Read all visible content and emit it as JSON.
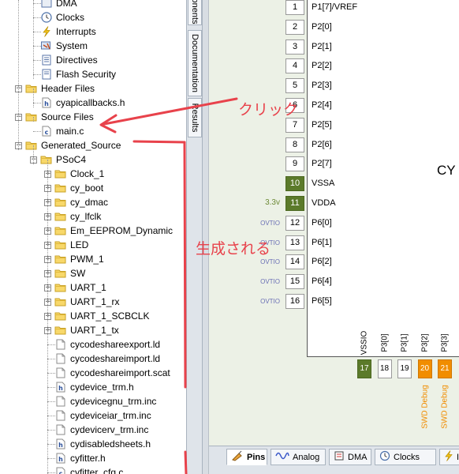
{
  "tree": {
    "items": [
      {
        "label": "DMA",
        "icon": "dma-icon",
        "level": 2
      },
      {
        "label": "Clocks",
        "icon": "clock-icon",
        "level": 2
      },
      {
        "label": "Interrupts",
        "icon": "lightning-icon",
        "level": 2
      },
      {
        "label": "System",
        "icon": "system-icon",
        "level": 2
      },
      {
        "label": "Directives",
        "icon": "document-icon",
        "level": 2
      },
      {
        "label": "Flash Security",
        "icon": "lock-icon",
        "level": 2
      },
      {
        "label": "Header Files",
        "icon": "folder-icon",
        "level": 1,
        "expander": "−"
      },
      {
        "label": "cyapicallbacks.h",
        "icon": "header-file-icon",
        "level": 2
      },
      {
        "label": "Source Files",
        "icon": "folder-icon",
        "level": 1,
        "expander": "−"
      },
      {
        "label": "main.c",
        "icon": "c-file-icon",
        "level": 2
      },
      {
        "label": "Generated_Source",
        "icon": "folder-icon",
        "level": 1,
        "expander": "−"
      },
      {
        "label": "PSoC4",
        "icon": "folder-icon",
        "level": 2,
        "expander": "−"
      },
      {
        "label": "Clock_1",
        "icon": "folder-icon",
        "level": 3,
        "expander": "+"
      },
      {
        "label": "cy_boot",
        "icon": "folder-icon",
        "level": 3,
        "expander": "+"
      },
      {
        "label": "cy_dmac",
        "icon": "folder-icon",
        "level": 3,
        "expander": "+"
      },
      {
        "label": "cy_lfclk",
        "icon": "folder-icon",
        "level": 3,
        "expander": "+"
      },
      {
        "label": "Em_EEPROM_Dynamic",
        "icon": "folder-icon",
        "level": 3,
        "expander": "+"
      },
      {
        "label": "LED",
        "icon": "folder-icon",
        "level": 3,
        "expander": "+"
      },
      {
        "label": "PWM_1",
        "icon": "folder-icon",
        "level": 3,
        "expander": "+"
      },
      {
        "label": "SW",
        "icon": "folder-icon",
        "level": 3,
        "expander": "+"
      },
      {
        "label": "UART_1",
        "icon": "folder-icon",
        "level": 3,
        "expander": "+"
      },
      {
        "label": "UART_1_rx",
        "icon": "folder-icon",
        "level": 3,
        "expander": "+"
      },
      {
        "label": "UART_1_SCBCLK",
        "icon": "folder-icon",
        "level": 3,
        "expander": "+"
      },
      {
        "label": "UART_1_tx",
        "icon": "folder-icon",
        "level": 3,
        "expander": "+"
      },
      {
        "label": "cycodeshareexport.ld",
        "icon": "file-icon",
        "level": 3
      },
      {
        "label": "cycodeshareimport.ld",
        "icon": "file-icon",
        "level": 3
      },
      {
        "label": "cycodeshareimport.scat",
        "icon": "file-icon",
        "level": 3
      },
      {
        "label": "cydevice_trm.h",
        "icon": "header-file-icon",
        "level": 3
      },
      {
        "label": "cydevicegnu_trm.inc",
        "icon": "file-icon",
        "level": 3
      },
      {
        "label": "cydeviceiar_trm.inc",
        "icon": "file-icon",
        "level": 3
      },
      {
        "label": "cydevicerv_trm.inc",
        "icon": "file-icon",
        "level": 3
      },
      {
        "label": "cydisabledsheets.h",
        "icon": "header-file-icon",
        "level": 3
      },
      {
        "label": "cyfitter.h",
        "icon": "header-file-icon",
        "level": 3
      },
      {
        "label": "cyfitter_cfg.c",
        "icon": "c-file-icon",
        "level": 3
      }
    ]
  },
  "side_tabs": [
    "onents",
    "Documentation",
    "Results"
  ],
  "chip": {
    "label": "CY",
    "left_pins": [
      {
        "num": "1",
        "name": "P1[7]/VREF",
        "note": "",
        "highlight": false
      },
      {
        "num": "2",
        "name": "P2[0]",
        "note": "",
        "highlight": false
      },
      {
        "num": "3",
        "name": "P2[1]",
        "note": "",
        "highlight": false
      },
      {
        "num": "4",
        "name": "P2[2]",
        "note": "",
        "highlight": false
      },
      {
        "num": "5",
        "name": "P2[3]",
        "note": "",
        "highlight": false
      },
      {
        "num": "6",
        "name": "P2[4]",
        "note": "",
        "highlight": false
      },
      {
        "num": "7",
        "name": "P2[5]",
        "note": "",
        "highlight": false
      },
      {
        "num": "8",
        "name": "P2[6]",
        "note": "",
        "highlight": false
      },
      {
        "num": "9",
        "name": "P2[7]",
        "note": "",
        "highlight": false
      },
      {
        "num": "10",
        "name": "VSSA",
        "note": "",
        "highlight": true
      },
      {
        "num": "11",
        "name": "VDDA",
        "note": "3.3v",
        "highlight": true
      },
      {
        "num": "12",
        "name": "P6[0]",
        "note": "OVTIO",
        "highlight": false
      },
      {
        "num": "13",
        "name": "P6[1]",
        "note": "OVTIO",
        "highlight": false
      },
      {
        "num": "14",
        "name": "P6[2]",
        "note": "OVTIO",
        "highlight": false
      },
      {
        "num": "15",
        "name": "P6[4]",
        "note": "OVTIO",
        "highlight": false
      },
      {
        "num": "16",
        "name": "P6[5]",
        "note": "OVTIO",
        "highlight": false
      }
    ],
    "bottom_pins": [
      {
        "num": "17",
        "name": "VSSIO",
        "style": "green",
        "debug": ""
      },
      {
        "num": "18",
        "name": "P3[0]",
        "style": "normal",
        "debug": ""
      },
      {
        "num": "19",
        "name": "P3[1]",
        "style": "normal",
        "debug": ""
      },
      {
        "num": "20",
        "name": "P3[2]",
        "style": "orange",
        "debug": "SWD Debug"
      },
      {
        "num": "21",
        "name": "P3[3]",
        "style": "orange",
        "debug": "SWD Debug"
      }
    ]
  },
  "bottom_tabs": [
    {
      "label": "Pins",
      "icon": "pins-icon",
      "active": true
    },
    {
      "label": "Analog",
      "icon": "analog-icon",
      "active": false
    },
    {
      "label": "DMA",
      "icon": "dma-icon",
      "active": false
    },
    {
      "label": "Clocks",
      "icon": "clock-icon",
      "active": false
    },
    {
      "label": "Ir",
      "icon": "interrupts-icon",
      "active": false
    }
  ],
  "annotations": {
    "click_text": "クリック",
    "generated_text": "生成される",
    "color": "#e8424b"
  }
}
